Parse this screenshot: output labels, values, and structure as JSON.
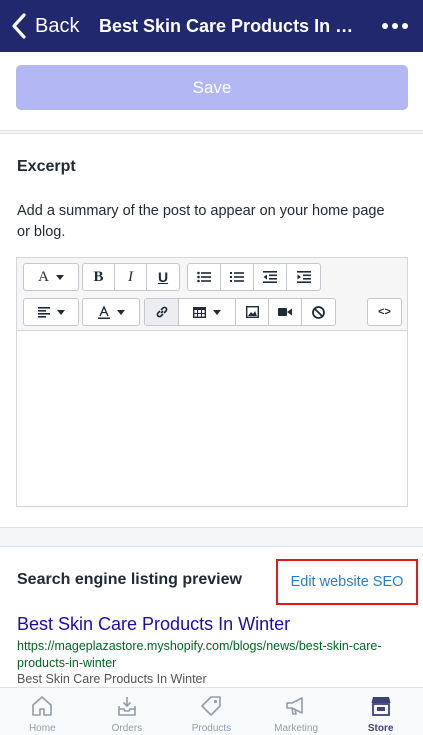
{
  "navbar": {
    "back_label": "Back",
    "title": "Best Skin Care Products In Winter"
  },
  "save": {
    "label": "Save"
  },
  "excerpt": {
    "title": "Excerpt",
    "description": "Add a summary of the post to appear on your home page or blog.",
    "toolbar": {
      "font": "A",
      "bold": "B",
      "italic": "I",
      "underline": "U",
      "source": "<>"
    }
  },
  "seo": {
    "title": "Search engine listing preview",
    "edit_link": "Edit website SEO",
    "preview": {
      "title": "Best Skin Care Products In Winter",
      "url": "https://mageplazastore.myshopify.com/blogs/news/best-skin-care-products-in-winter",
      "description": "Best Skin Care Products In Winter"
    }
  },
  "tabs": [
    {
      "label": "Home",
      "icon": "home-icon"
    },
    {
      "label": "Orders",
      "icon": "orders-icon"
    },
    {
      "label": "Products",
      "icon": "tag-icon"
    },
    {
      "label": "Marketing",
      "icon": "megaphone-icon"
    },
    {
      "label": "Store",
      "icon": "store-icon",
      "active": true
    }
  ],
  "colors": {
    "navbar": "#22286e",
    "save_disabled": "#b3b7f4",
    "link": "#2a7fc1",
    "preview_title": "#1a0dab",
    "preview_url": "#006621",
    "highlight": "#e01b1b"
  }
}
